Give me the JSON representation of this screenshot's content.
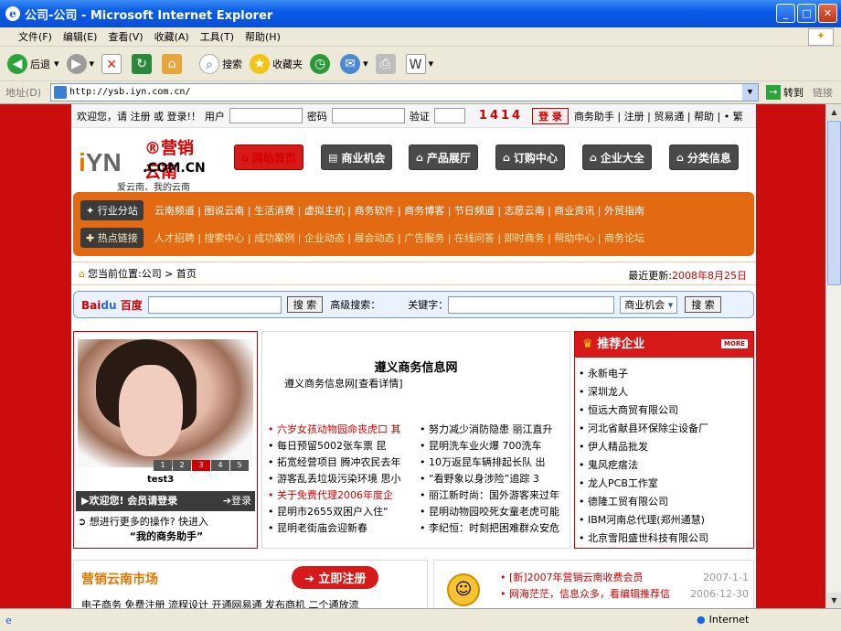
{
  "window": {
    "title": "公司-公司 - Microsoft Internet Explorer"
  },
  "menu": [
    "文件(F)",
    "编辑(E)",
    "查看(V)",
    "收藏(A)",
    "工具(T)",
    "帮助(H)"
  ],
  "toolbar": {
    "back": "后退",
    "search": "搜索",
    "favorites": "收藏夹"
  },
  "address": {
    "label": "地址(D)",
    "url": "http://ysb.iyn.com.cn/",
    "go": "转到",
    "links": "链接"
  },
  "status": {
    "zone": "Internet"
  },
  "login": {
    "welcome": "欢迎您，请 注册 或 登录!！",
    "user_label": "用户",
    "pwd_label": "密码",
    "code_label": "验证",
    "code": "1414",
    "login_btn": "登 录",
    "links": "商务助手 | 注册 | 贸易通 | 帮助 | • 繁"
  },
  "logo": {
    "reg": "®营销云南",
    "yn": "YN",
    "com": ".COM.CN",
    "tagline": "爱云南、我的云南"
  },
  "nav": [
    "网站首页",
    "商业机会",
    "产品展厅",
    "订购中心",
    "企业大全",
    "分类信息"
  ],
  "channels": {
    "row1_badge": "行业分站",
    "row1": "云南频道 | 图说云南 | 生活消费 | 虚拟主机 | 商务软件 | 商务博客 | 节日频道 | 志愿云南 | 商业资讯 | 外贸指南",
    "row2_badge": "热点链接",
    "row2": "人才招聘 | 搜索中心 | 成功案例 | 企业动态 | 展会动态 | 广告服务 | 在线问答 | 即时商务 | 帮助中心 | 商务论坛"
  },
  "breadcrumb": {
    "text": "您当前位置:公司 > 首页",
    "updated_label": "最近更新:",
    "updated_date": "2008年8月25日"
  },
  "search": {
    "engine": "百度",
    "btn": "搜 索",
    "adv_label": "高级搜索：",
    "kw_label": "关键字：",
    "category": "商业机会",
    "btn2": "搜 索"
  },
  "slideshow": {
    "caption": "test3",
    "pages": [
      "1",
      "2",
      "3",
      "4",
      "5"
    ],
    "active": 3
  },
  "member": {
    "welcome": "▶欢迎您! 会员请登录",
    "login": "登录",
    "more": "想进行更多的操作? 快进入",
    "more_bold": "“我的商务助手”"
  },
  "mid": {
    "title": "遵义商务信息网",
    "sub": "遵义商务信息网[查看详情]",
    "news_left": [
      {
        "t": "• 六岁女孩动物园命丧虎口  其",
        "hl": true
      },
      {
        "t": "• 每日预留5002张车票  昆",
        "hl": false
      },
      {
        "t": "• 拓宽经营项目  腾冲农民去年",
        "hl": false
      },
      {
        "t": "• 游客乱丢垃圾污染环境  思小",
        "hl": false
      },
      {
        "t": "• 关于免费代理2006年度企",
        "hl": true
      },
      {
        "t": "• 昆明市2655双困户入住“",
        "hl": false
      },
      {
        "t": "• 昆明老街庙会迎新春",
        "hl": false
      }
    ],
    "news_right": [
      "• 努力减少消防隐患  丽江直升",
      "• 昆明洗车业火爆  700洗车",
      "• 10万返昆车辆排起长队  出",
      "• “看野象以身涉险”追踪 3",
      "• 丽江新时尚：国外游客来过年",
      "• 昆明动物园咬死女童老虎可能",
      "• 李纪恒：时刻把困难群众安危"
    ]
  },
  "recommend": {
    "title": "推荐企业",
    "more": "MORE",
    "items": [
      "永新电子",
      "深圳龙人",
      "恒远大商贸有限公司",
      "河北省献县环保除尘设备厂",
      "伊人精品批发",
      "鬼风疙瘩法",
      "龙人PCB工作室",
      "德隆工贸有限公司",
      "IBM河南总代理(郑州通慧)",
      "北京雪阳盛世科技有限公司"
    ]
  },
  "market": {
    "title": "营销云南市场",
    "register": "立即注册",
    "tabs": "电子商务  免费注册  流程设计  开通网易通  发布商机  二个通放流"
  },
  "announce": [
    {
      "t": "• [新]2007年营销云南收费会员",
      "d": "2007-1-1"
    },
    {
      "t": "• 网海茫茫，信息众多，看编辑推荐信",
      "d": "2006-12-30"
    }
  ],
  "colors": {
    "accent": "#d61a1a",
    "orange": "#e36a12",
    "frame_red": "#cc0d0d"
  }
}
